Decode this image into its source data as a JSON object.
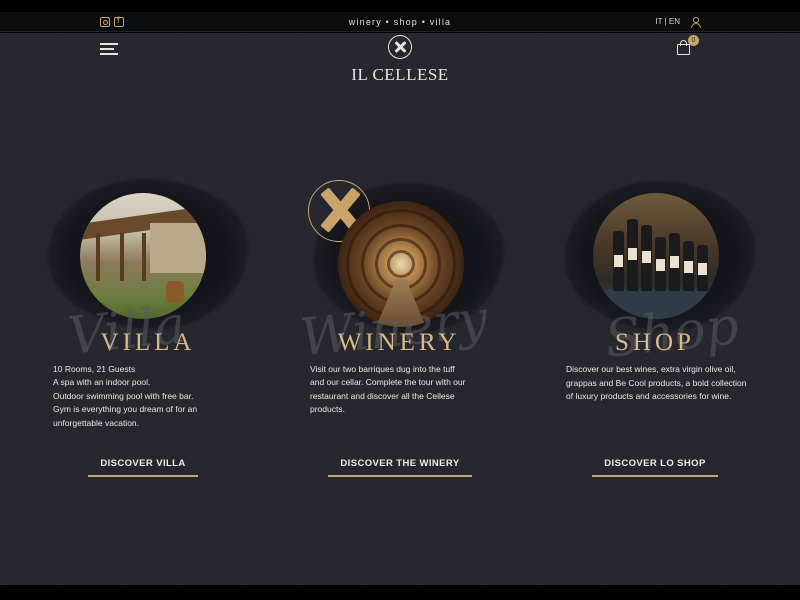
{
  "topbar": {
    "tagline": "winery • shop • villa",
    "lang_it": "IT",
    "lang_sep": "|",
    "lang_en": "EN",
    "social_icons": [
      "instagram-icon",
      "facebook-icon"
    ]
  },
  "header": {
    "logo_text": "IL CELLESE",
    "cart_count": "0"
  },
  "theme": {
    "accent": "#c9a468",
    "title_color": "#d9b985",
    "background": "#26272f"
  },
  "cards": [
    {
      "script": "Villa",
      "title": "VILLA",
      "lines": [
        "10 Rooms, 21 Guests",
        "A spa with an indoor pool.",
        "Outdoor swimming pool with free bar.",
        "Gym is everything you dream of for an",
        "unforgettable vacation."
      ],
      "cta": "DISCOVER VILLA"
    },
    {
      "script": "Winery",
      "title": "WINERY",
      "lines": [
        "Visit our two barriques dug into the tuff",
        "and our cellar. Complete the tour with our",
        "restaurant and discover all the Cellese",
        "products."
      ],
      "cta": "DISCOVER THE WINERY"
    },
    {
      "script": "Shop",
      "title": "SHOP",
      "lines": [
        "Discover our best wines, extra virgin olive oil,",
        "grappas and Be Cool products, a bold collection",
        "of luxury products and accessories for wine."
      ],
      "cta": "DISCOVER LO SHOP"
    }
  ]
}
